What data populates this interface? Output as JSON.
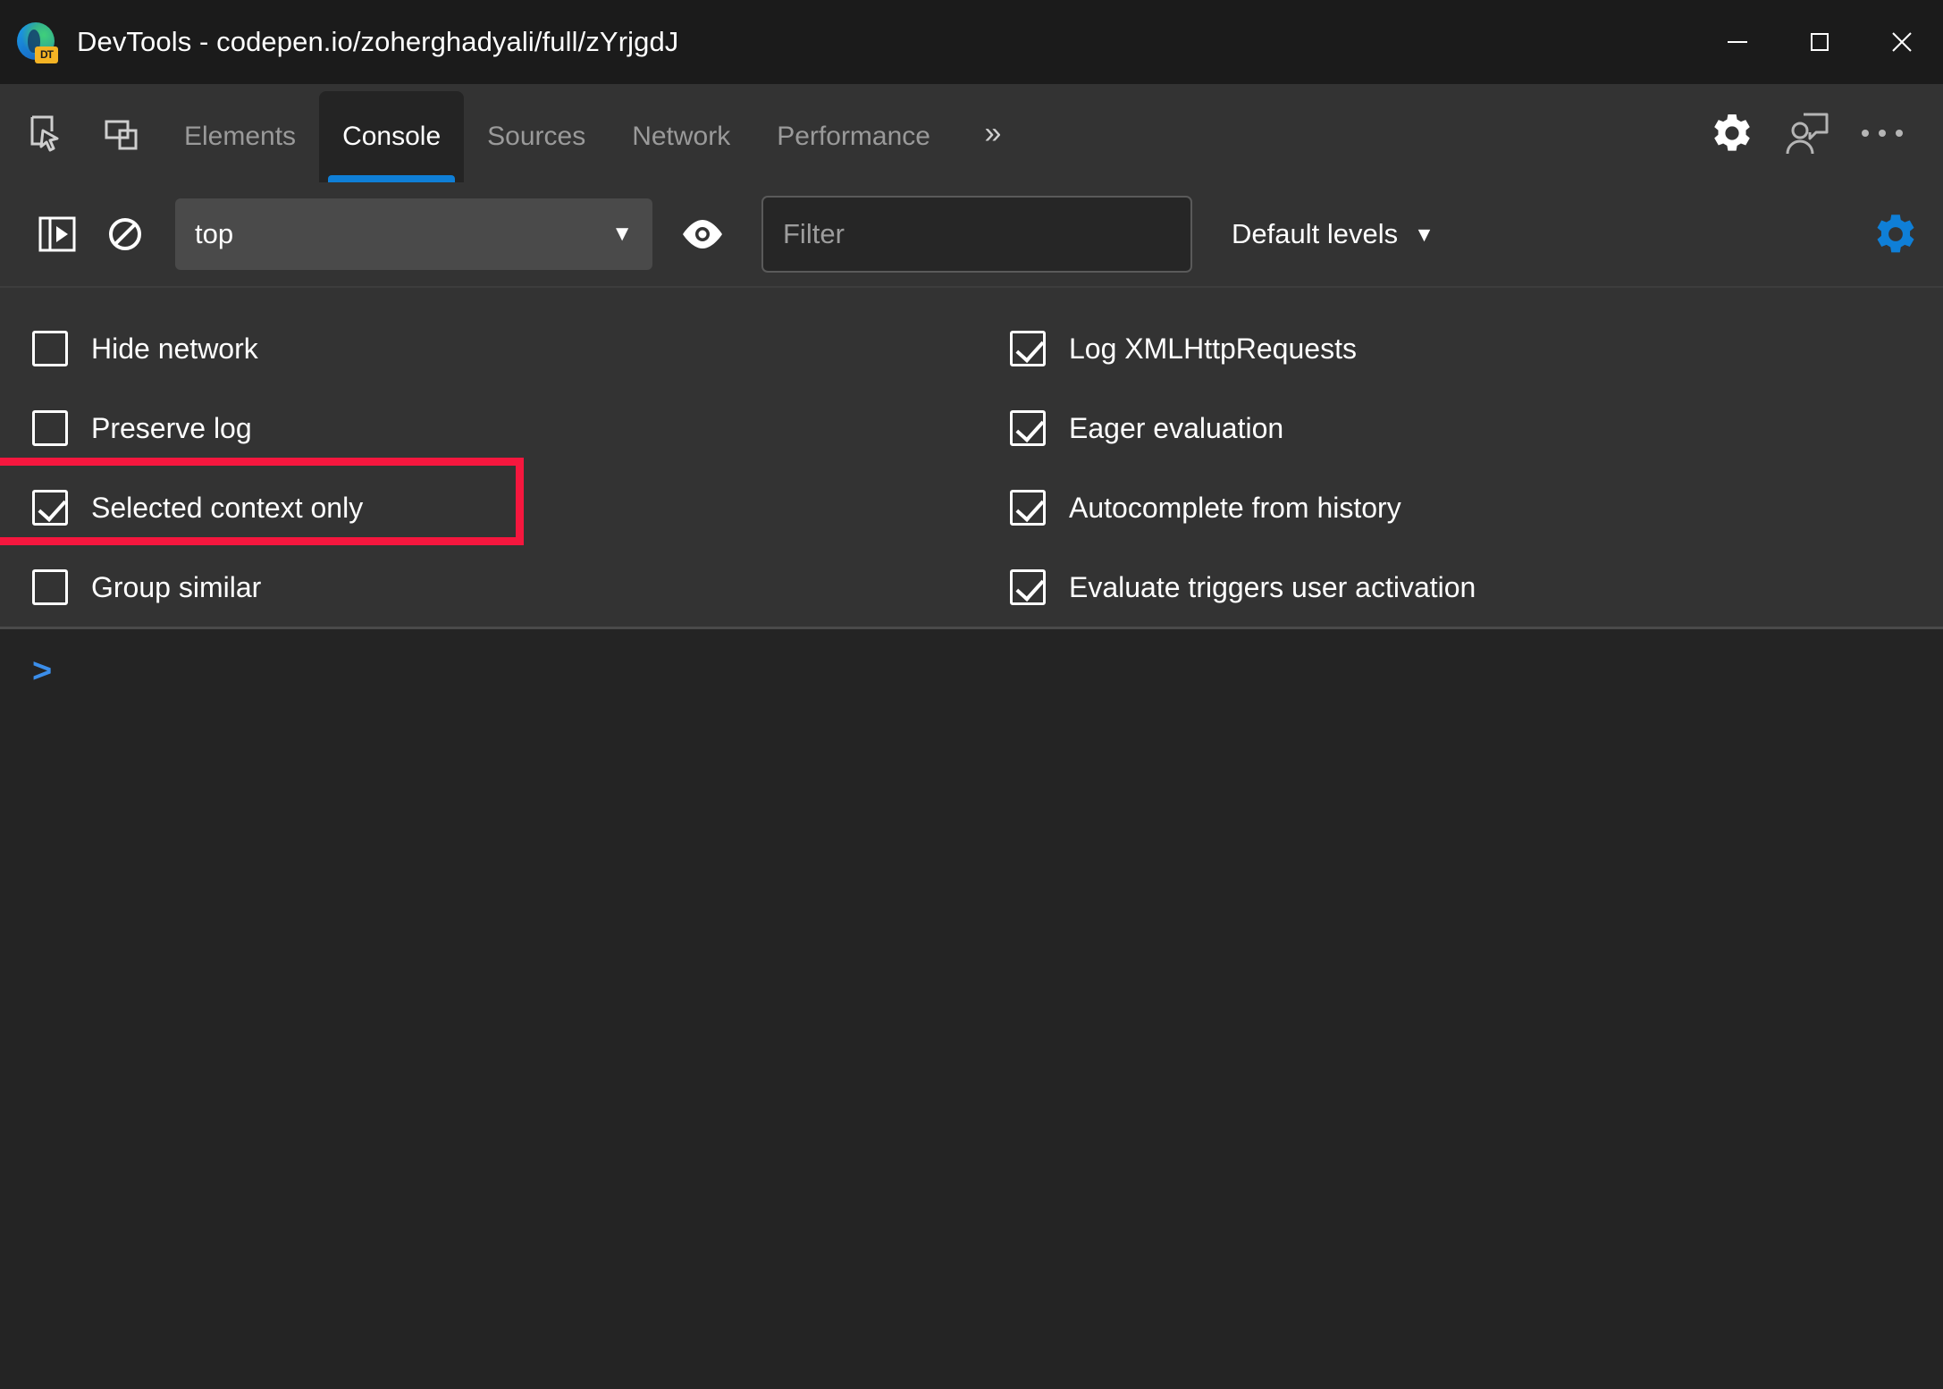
{
  "window": {
    "title": "DevTools - codepen.io/zoherghadyali/full/zYrjgdJ",
    "logo_icon": "edge-devtools-logo-icon",
    "logo_badge": "DT",
    "controls": {
      "minimize": "minimize-icon",
      "maximize": "maximize-icon",
      "close": "close-icon"
    }
  },
  "tabbar": {
    "inspect_icon": "inspect-element-icon",
    "device_icon": "device-emulation-icon",
    "tabs": [
      {
        "label": "Elements",
        "active": false
      },
      {
        "label": "Console",
        "active": true
      },
      {
        "label": "Sources",
        "active": false
      },
      {
        "label": "Network",
        "active": false
      },
      {
        "label": "Performance",
        "active": false
      }
    ],
    "overflow_label": "»",
    "settings_icon": "gear-icon",
    "feedback_icon": "feedback-person-icon",
    "more_icon": "more-options-icon"
  },
  "console_toolbar": {
    "sidebar_toggle_icon": "console-sidebar-toggle-icon",
    "clear_icon": "clear-console-icon",
    "context": {
      "value": "top",
      "caret": "▼"
    },
    "eye_icon": "live-expression-eye-icon",
    "filter": {
      "value": "",
      "placeholder": "Filter"
    },
    "levels": {
      "label": "Default levels",
      "caret": "▼"
    },
    "settings_gear_icon": "console-settings-gear-icon",
    "settings_gear_color": "#0f7fd7"
  },
  "settings_pane": {
    "left_column": [
      {
        "label": "Hide network",
        "checked": false
      },
      {
        "label": "Preserve log",
        "checked": false
      },
      {
        "label": "Selected context only",
        "checked": true,
        "highlighted": true
      },
      {
        "label": "Group similar",
        "checked": false
      }
    ],
    "right_column": [
      {
        "label": "Log XMLHttpRequests",
        "checked": true
      },
      {
        "label": "Eager evaluation",
        "checked": true
      },
      {
        "label": "Autocomplete from history",
        "checked": true
      },
      {
        "label": "Evaluate triggers user activation",
        "checked": true
      }
    ],
    "highlight_color": "#f5173e"
  },
  "console": {
    "prompt_symbol": ">",
    "prompt_color": "#3b8eea",
    "input_value": ""
  },
  "colors": {
    "titlebar_bg": "#1b1b1b",
    "toolbar_bg": "#333333",
    "console_bg": "#242424",
    "accent_blue": "#0f7fd7",
    "text_primary": "#ffffff",
    "text_muted": "#9a9a9a"
  }
}
